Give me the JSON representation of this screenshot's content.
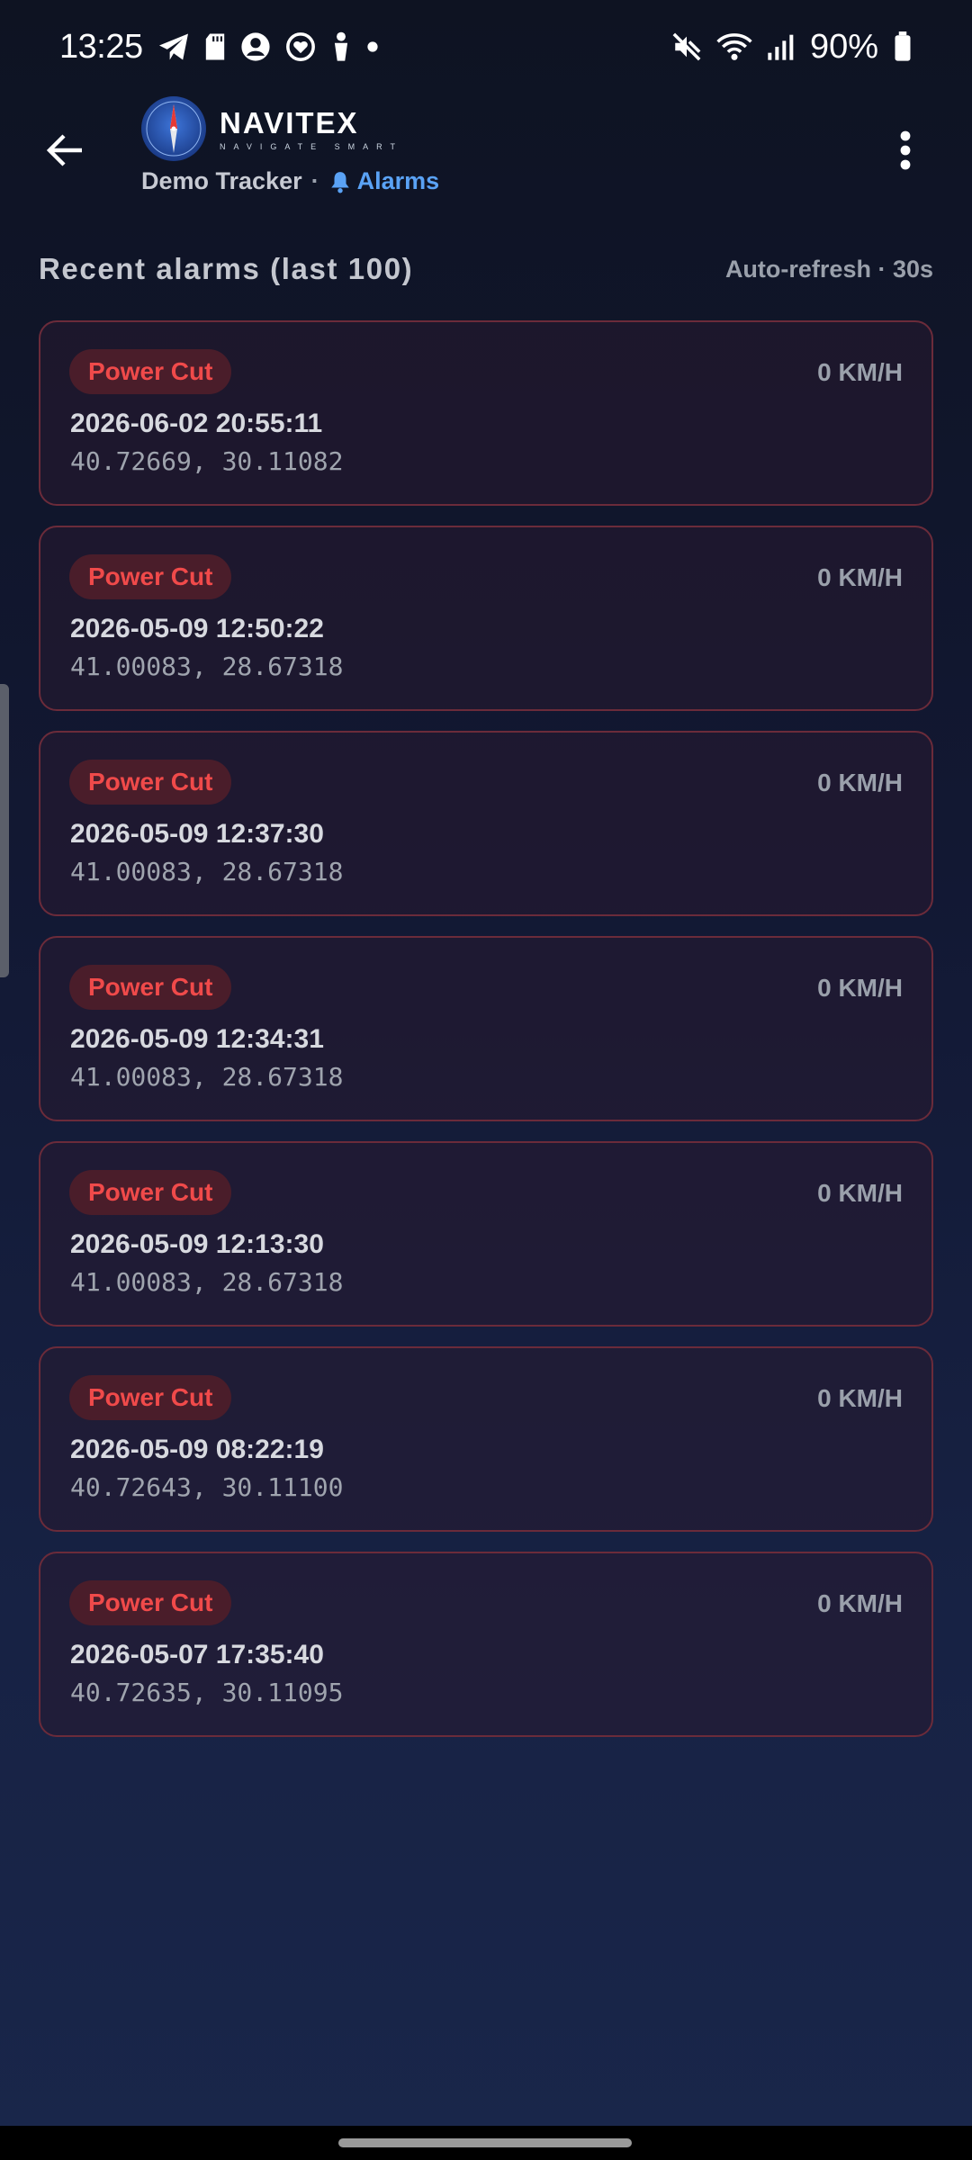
{
  "status_bar": {
    "time": "13:25",
    "left_icons": [
      "telegram-icon",
      "sd-card-icon",
      "account-circle-icon",
      "heart-badge-icon",
      "figure-icon",
      "dot-icon"
    ],
    "right_icons": [
      "mute-icon",
      "wifi-icon",
      "signal-icon",
      "battery-icon"
    ],
    "battery": "90%"
  },
  "app_bar": {
    "brand_name": "NAVITEX",
    "brand_tagline": "NAVIGATE SMART",
    "device": "Demo Tracker",
    "separator": "·",
    "section": "Alarms"
  },
  "header": {
    "title": "Recent alarms (last 100)",
    "auto_refresh": "Auto-refresh · 30s"
  },
  "alarms": [
    {
      "type": "Power Cut",
      "speed": "0 KM/H",
      "time": "2026-06-02 20:55:11",
      "coords": "40.72669, 30.11082"
    },
    {
      "type": "Power Cut",
      "speed": "0 KM/H",
      "time": "2026-05-09 12:50:22",
      "coords": "41.00083, 28.67318"
    },
    {
      "type": "Power Cut",
      "speed": "0 KM/H",
      "time": "2026-05-09 12:37:30",
      "coords": "41.00083, 28.67318"
    },
    {
      "type": "Power Cut",
      "speed": "0 KM/H",
      "time": "2026-05-09 12:34:31",
      "coords": "41.00083, 28.67318"
    },
    {
      "type": "Power Cut",
      "speed": "0 KM/H",
      "time": "2026-05-09 12:13:30",
      "coords": "41.00083, 28.67318"
    },
    {
      "type": "Power Cut",
      "speed": "0 KM/H",
      "time": "2026-05-09 08:22:19",
      "coords": "40.72643, 30.11100"
    },
    {
      "type": "Power Cut",
      "speed": "0 KM/H",
      "time": "2026-05-07 17:35:40",
      "coords": "40.72635, 30.11095"
    }
  ],
  "colors": {
    "accent": "#5aa2f5",
    "alarm_red": "#f04a4a",
    "card_border": "#6b2b3a"
  }
}
